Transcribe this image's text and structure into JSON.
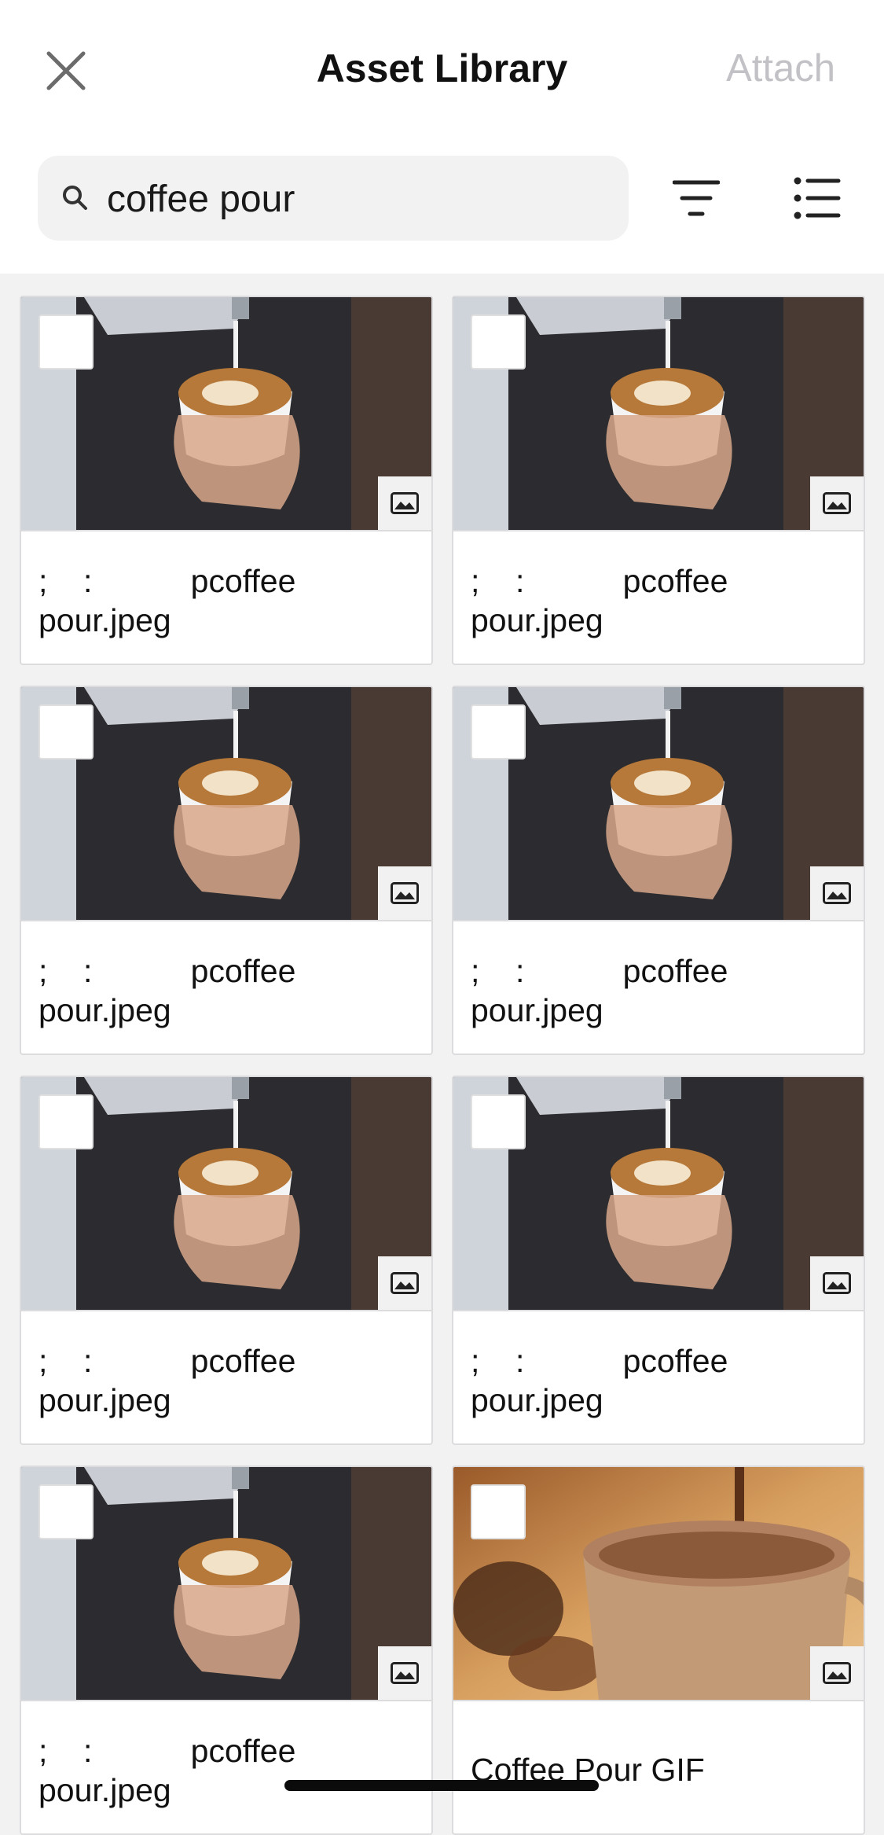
{
  "header": {
    "title": "Asset Library",
    "attach_label": "Attach",
    "close_icon": "close-icon"
  },
  "search": {
    "value": "coffee pour",
    "icon": "search-icon"
  },
  "toolbar": {
    "filter_icon": "filter-icon",
    "list_view_icon": "list-view-icon"
  },
  "assets": [
    {
      "label": ";    :           pcoffee\npour.jpeg",
      "thumbnail": "latte-art-pour",
      "type_icon": "image-icon"
    },
    {
      "label": ";    :           pcoffee\npour.jpeg",
      "thumbnail": "latte-art-pour",
      "type_icon": "image-icon"
    },
    {
      "label": ";    :           pcoffee\npour.jpeg",
      "thumbnail": "latte-art-pour",
      "type_icon": "image-icon"
    },
    {
      "label": ";    :           pcoffee\npour.jpeg",
      "thumbnail": "latte-art-pour",
      "type_icon": "image-icon"
    },
    {
      "label": ";    :           pcoffee\npour.jpeg",
      "thumbnail": "latte-art-pour",
      "type_icon": "image-icon"
    },
    {
      "label": ";    :           pcoffee\npour.jpeg",
      "thumbnail": "latte-art-pour",
      "type_icon": "image-icon"
    },
    {
      "label": ";    :           pcoffee\npour.jpeg",
      "thumbnail": "latte-art-pour",
      "type_icon": "image-icon"
    },
    {
      "label": "Coffee Pour GIF",
      "thumbnail": "coffee-mug-pour",
      "type_icon": "image-icon"
    }
  ],
  "colors": {
    "accent_disabled": "#c2c2c6",
    "background": "#f2f2f3"
  }
}
